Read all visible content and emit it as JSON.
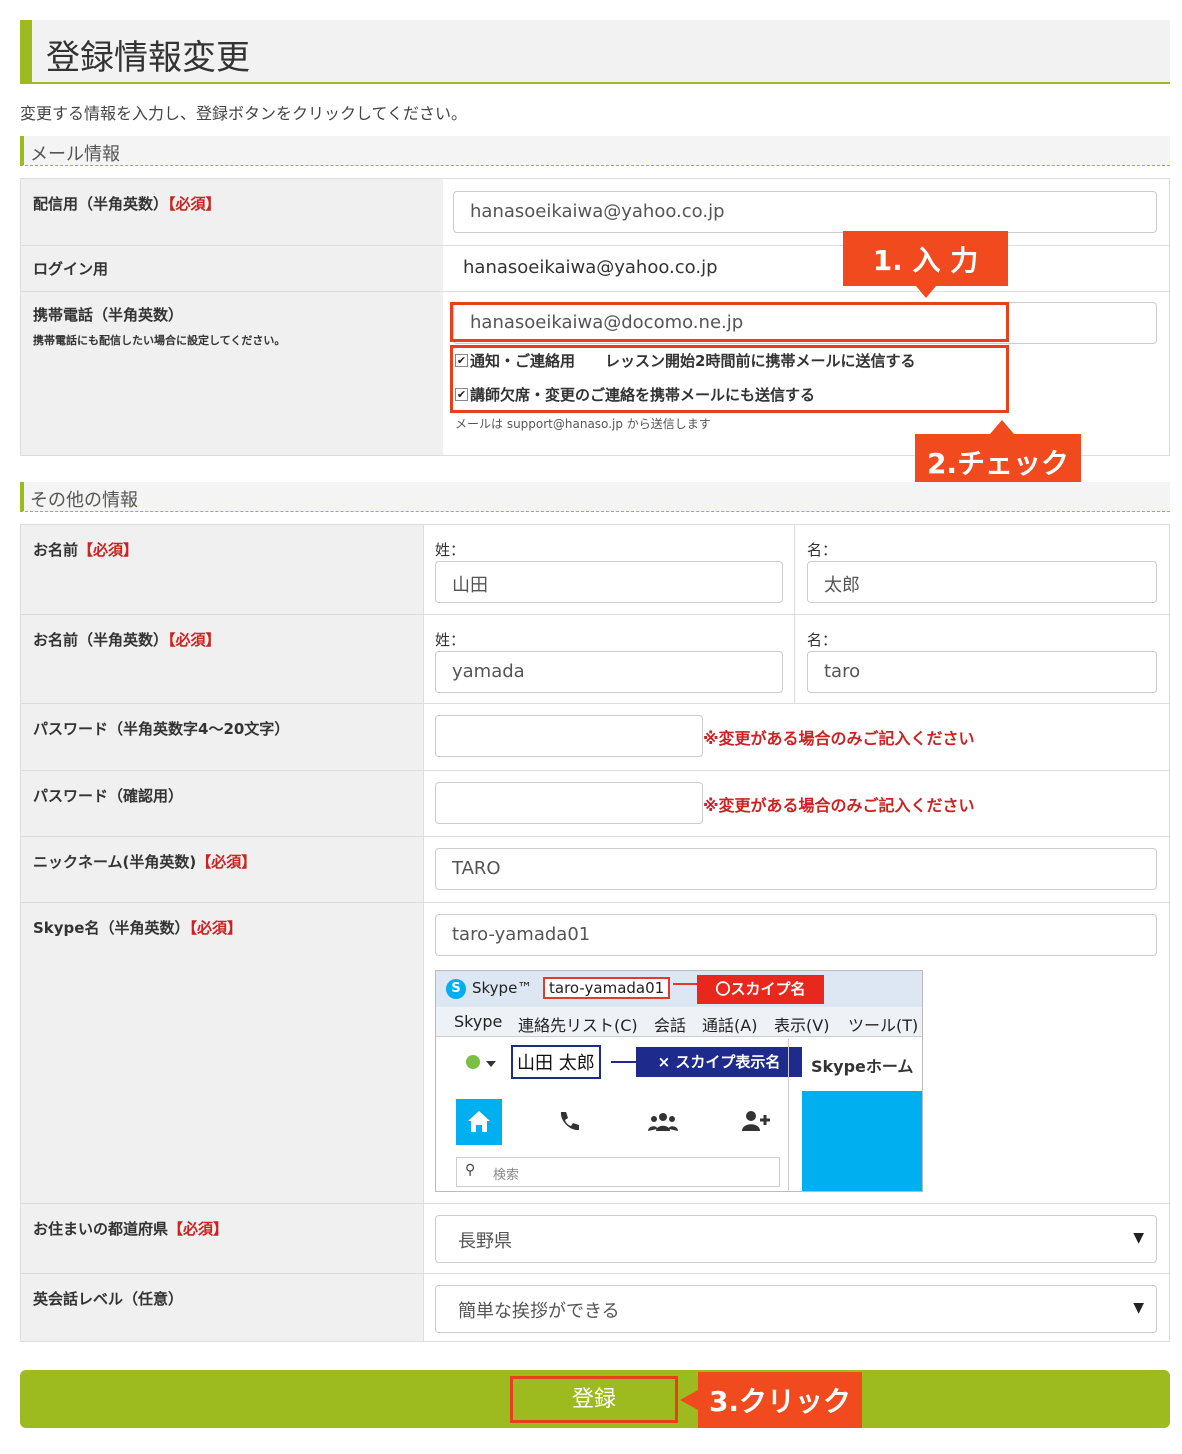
{
  "header": {
    "title": "登録情報変更",
    "intro": "変更する情報を入力し、登録ボタンをクリックしてください。"
  },
  "mail_section": {
    "title": "メール情報",
    "delivery": {
      "label": "配信用（半角英数）",
      "required": "【必須】",
      "value": "hanasoeikaiwa@yahoo.co.jp"
    },
    "login": {
      "label": "ログイン用",
      "value": "hanasoeikaiwa@yahoo.co.jp"
    },
    "mobile": {
      "label": "携帯電話（半角英数）",
      "sub": "携帯電話にも配信したい場合に設定してください。",
      "value": "hanasoeikaiwa@docomo.ne.jp",
      "check1": "通知・ご連絡用　　レッスン開始2時間前に携帯メールに送信する",
      "check2": "講師欠席・変更のご連絡を携帯メールにも送信する",
      "check_mark": "✔",
      "note": "メールは support@hanaso.jp から送信します"
    }
  },
  "other_section": {
    "title": "その他の情報",
    "name": {
      "label": "お名前",
      "required": "【必須】",
      "sei_label": "姓：",
      "mei_label": "名：",
      "sei": "山田",
      "mei": "太郎"
    },
    "name_roman": {
      "label": "お名前（半角英数）",
      "required": "【必須】",
      "sei_label": "姓：",
      "mei_label": "名：",
      "sei": "yamada",
      "mei": "taro"
    },
    "password": {
      "label": "パスワード（半角英数字4～20文字）",
      "note": "※変更がある場合のみご記入ください"
    },
    "password_confirm": {
      "label": "パスワード（確認用）",
      "note": "※変更がある場合のみご記入ください"
    },
    "nickname": {
      "label": "ニックネーム(半角英数)",
      "required": "【必須】",
      "value": "TARO"
    },
    "skype": {
      "label": "Skype名（半角英数）",
      "required": "【必須】",
      "value": "taro-yamada01"
    },
    "prefecture": {
      "label": "お住まいの都道府県",
      "required": "【必須】",
      "value": "長野県",
      "arrow": "▼"
    },
    "level": {
      "label": "英会話レベル（任意）",
      "value": "簡単な挨拶ができる",
      "arrow": "▼"
    }
  },
  "skype_window": {
    "app": "Skype™",
    "username": "taro-yamada01",
    "ok_label": "〇スカイプ名",
    "menu": [
      "Skype",
      "連絡先リスト(C)",
      "会話",
      "通話(A)",
      "表示(V)",
      "ツール(T)"
    ],
    "display_name": "山田 太郎",
    "ng_label": "× スカイプ表示名",
    "home": "Skypeホーム",
    "search": "検索",
    "logo_letter": "S"
  },
  "callouts": {
    "step1": "1. 入 力",
    "step2": "2.チェック",
    "step3": "3.クリック"
  },
  "submit": {
    "label": "登録"
  },
  "colors": {
    "accent": "#9dbb1f",
    "callout": "#f04a1e",
    "required": "#cc2222",
    "skype_blue": "#00aff0",
    "ng_navy": "#1e2a8c"
  }
}
